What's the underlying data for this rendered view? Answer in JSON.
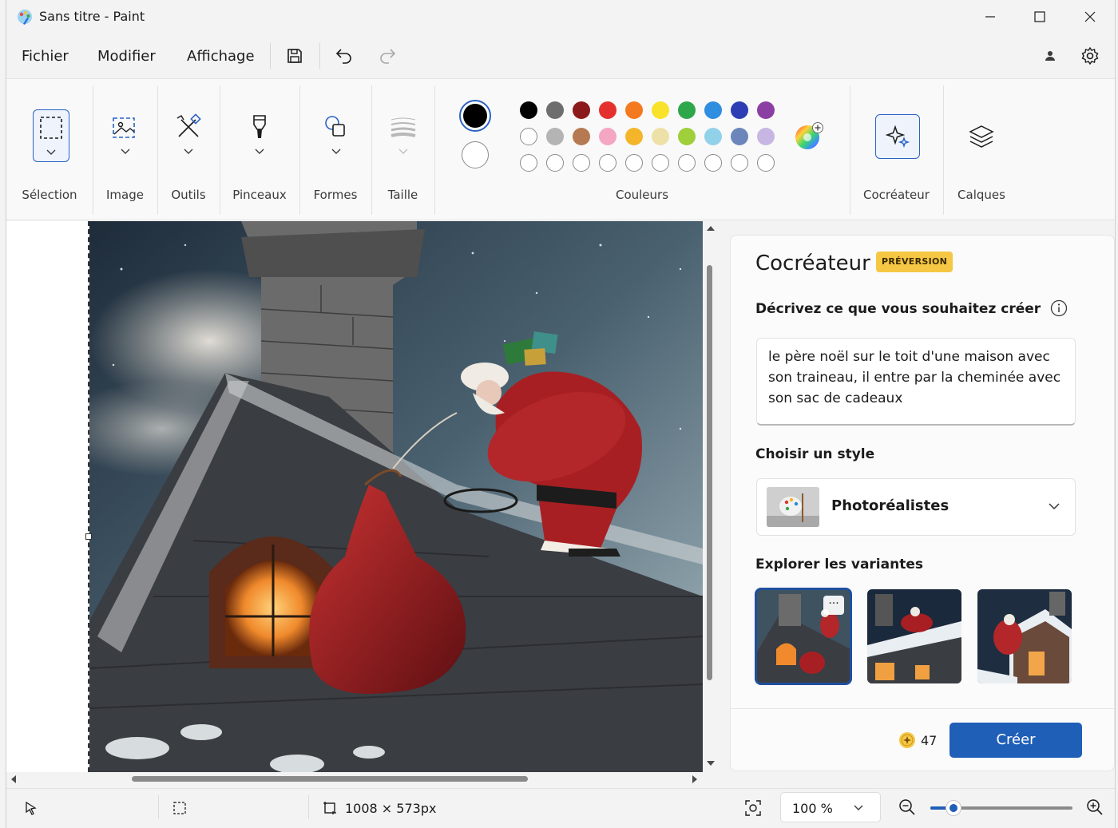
{
  "window": {
    "title": "Sans titre - Paint"
  },
  "menu": {
    "items": [
      "Fichier",
      "Modifier",
      "Affichage"
    ]
  },
  "ribbon": {
    "groups": {
      "selection": "Sélection",
      "image": "Image",
      "tools": "Outils",
      "brushes": "Pinceaux",
      "shapes": "Formes",
      "size": "Taille",
      "colors": "Couleurs",
      "cocreator": "Cocréateur",
      "layers": "Calques"
    },
    "primary_color": "#000000",
    "secondary_color": "#ffffff",
    "palette_row1": [
      "#000000",
      "#6e6e6e",
      "#8b1a1a",
      "#e5312e",
      "#f47a20",
      "#f8e32a",
      "#2ea64a",
      "#2f8ee0",
      "#2d3eb5",
      "#8c3fa3"
    ],
    "palette_row2": [
      "#ffffff",
      "#b4b4b4",
      "#b57a52",
      "#f5a6c3",
      "#f4b52a",
      "#eee1a8",
      "#9fcf3a",
      "#92d1ea",
      "#6c86bb",
      "#c7b6e4"
    ],
    "palette_row3_empty": 10
  },
  "panel": {
    "title": "Cocréateur",
    "badge": "PRÉVERSION",
    "describe_label": "Décrivez ce que vous souhaitez créer",
    "prompt": "le père noël sur le toit d'une maison avec son traineau, il entre par la cheminée avec son sac de cadeaux",
    "style_label": "Choisir un style",
    "style_value": "Photoréalistes",
    "variants_label": "Explorer les variantes",
    "variant_more": "···",
    "credits": "47",
    "create_button": "Créer"
  },
  "status": {
    "dimensions": "1008 × 573px",
    "zoom": "100 %",
    "zoom_level_percent": 100
  }
}
